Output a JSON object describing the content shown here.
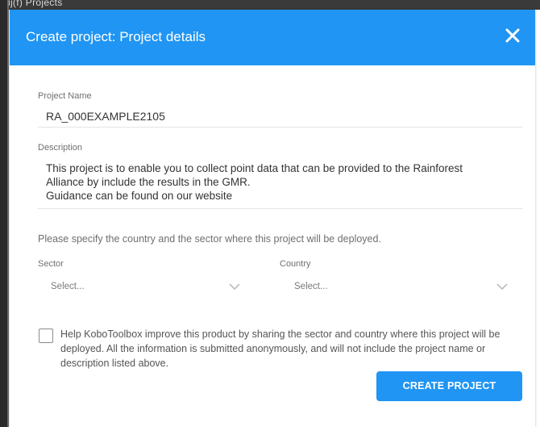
{
  "background": {
    "partial_text": "ij(f) Projects"
  },
  "modal": {
    "title": "Create project: Project details",
    "close_icon": "close-icon"
  },
  "form": {
    "project_name": {
      "label": "Project Name",
      "value": "RA_000EXAMPLE2105"
    },
    "description": {
      "label": "Description",
      "lines": [
        "This project is to enable you to collect point data that can be provided to the Rainforest",
        "Alliance by include the results in the GMR.",
        "Guidance can be found on our website"
      ]
    },
    "hint": "Please specify the country and the sector where this project will be deployed.",
    "sector": {
      "label": "Sector",
      "placeholder": "Select..."
    },
    "country": {
      "label": "Country",
      "placeholder": "Select..."
    },
    "consent": {
      "checked": false,
      "text": "Help KoboToolbox improve this product by sharing the sector and country where this project will be deployed. All the information is submitted anonymously, and will not include the project name or description listed above."
    },
    "submit_label": "CREATE PROJECT"
  },
  "colors": {
    "header": "#2095f3",
    "button": "#2095f3"
  }
}
